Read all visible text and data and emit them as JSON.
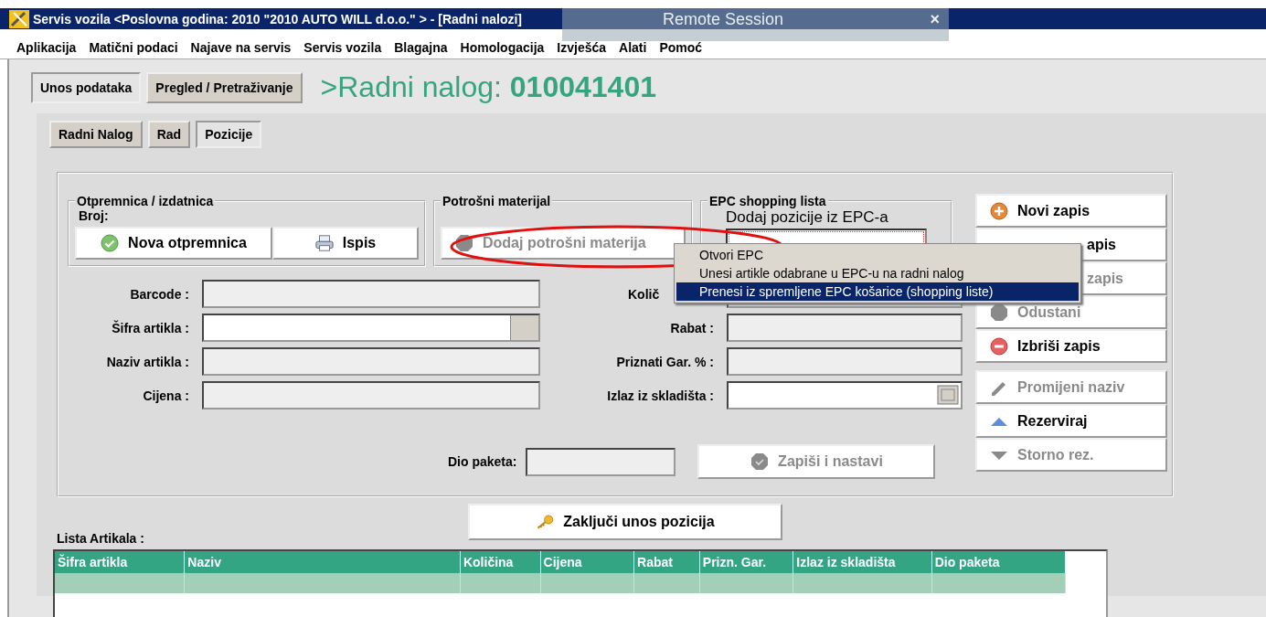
{
  "window": {
    "title": "Servis vozila <Poslovna godina: 2010 \"2010 AUTO WILL d.o.o.\" > - [Radni nalozi]"
  },
  "remote_session": {
    "title": "Remote Session",
    "close": "×"
  },
  "menu": [
    "Aplikacija",
    "Matični podaci",
    "Najave na servis",
    "Servis vozila",
    "Blagajna",
    "Homologacija",
    "Izvješća",
    "Alati",
    "Pomoć"
  ],
  "mode_tabs": [
    {
      "label": "Unos podataka",
      "selected": true
    },
    {
      "label": "Pregled / Pretraživanje",
      "selected": false
    }
  ],
  "heading": ">Radni nalog: **010041401**",
  "sub_tabs": [
    {
      "label": "Radni Nalog",
      "selected": false
    },
    {
      "label": "Rad",
      "selected": false
    },
    {
      "label": "Pozicije",
      "selected": true
    }
  ],
  "otpremnica": {
    "title": "Otpremnica / izdatnica",
    "broj_label": "Broj:",
    "buttons": [
      {
        "label": "Nova otpremnica",
        "kind": "check"
      },
      {
        "label": "Ispis",
        "kind": "printer"
      }
    ]
  },
  "potrosni": {
    "title": "Potrošni materijal",
    "button": {
      "label": "Dodaj potrošni materija",
      "disabled": true
    }
  },
  "epc": {
    "title": "EPC shopping lista",
    "subtitle": "Dodaj pozicije iz EPC-a"
  },
  "left_fields": [
    {
      "label": "Barcode :",
      "kind": "readonly"
    },
    {
      "label": "Šifra artikla :",
      "kind": "lookup"
    },
    {
      "label": "Naziv artikla :",
      "kind": "readonly"
    },
    {
      "label": "Cijena :",
      "kind": "readonly"
    }
  ],
  "right_fields": [
    {
      "label": "Količ",
      "kind": "readonly"
    },
    {
      "label": "Rabat :",
      "kind": "readonly"
    },
    {
      "label": "Priznati Gar. % :",
      "kind": "readonly"
    },
    {
      "label": "Izlaz iz skladišta :",
      "kind": "date"
    }
  ],
  "dio_paketa": {
    "label": "Dio paketa:"
  },
  "save_button": {
    "label": "Zapiši i nastavi",
    "disabled": true
  },
  "actions": [
    {
      "label": "Novi zapis",
      "kind": "plus",
      "disabled": false
    },
    {
      "label": "apis",
      "kind": "none",
      "disabled": false
    },
    {
      "label": "zapis",
      "kind": "none",
      "disabled": true
    },
    {
      "label": "Odustani",
      "kind": "stop",
      "disabled": true
    },
    {
      "label": "Izbriši zapis",
      "kind": "minus",
      "disabled": false
    }
  ],
  "actions2": [
    {
      "label": "Promijeni naziv",
      "kind": "pencil",
      "disabled": true
    },
    {
      "label": "Rezerviraj",
      "kind": "up",
      "disabled": false
    },
    {
      "label": "Storno rez.",
      "kind": "down",
      "disabled": true
    }
  ],
  "context_menu": [
    {
      "label": "Otvori EPC",
      "selected": false
    },
    {
      "label": "Unesi artikle odabrane u EPC-u na radni nalog",
      "selected": false
    },
    {
      "label": "Prenesi iz spremljene EPC košarice (shopping liste)",
      "selected": true
    }
  ],
  "finish_button": "Zaključi unos pozicija",
  "table": {
    "title": "Lista Artikala :",
    "columns": [
      "Šifra artikla",
      "Naziv",
      "Količina",
      "Cijena",
      "Rabat",
      "Prizn. Gar.",
      "Izlaz iz skladišta",
      "Dio paketa"
    ]
  }
}
